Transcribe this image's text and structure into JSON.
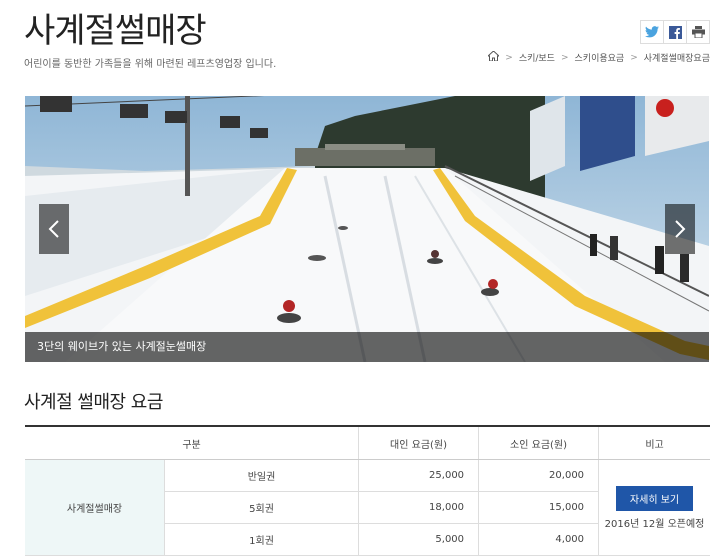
{
  "header": {
    "title": "사계절썰매장",
    "subtitle": "어린이를 동반한 가족들을 위해 마련된 레프츠영업장 입니다."
  },
  "share": {
    "icons": [
      "twitter-icon",
      "facebook-icon",
      "print-icon"
    ]
  },
  "breadcrumb": {
    "items": [
      "스키/보드",
      "스키이용요금",
      "사계절썰매장요금"
    ]
  },
  "hero": {
    "caption": "3단의 웨이브가 있는 사계절눈썰매장"
  },
  "fees": {
    "title": "사계절 썰매장 요금",
    "headers": [
      "구분",
      "대인 요금(원)",
      "소인 요금(원)",
      "비고"
    ],
    "category": "사계절썰매장",
    "rows": [
      {
        "ticket": "반일권",
        "adult": "25,000",
        "child": "20,000"
      },
      {
        "ticket": "5회권",
        "adult": "18,000",
        "child": "15,000"
      },
      {
        "ticket": "1회권",
        "adult": "5,000",
        "child": "4,000"
      }
    ],
    "detail_button": "자세히 보기",
    "note": "2016년 12월 오픈예정"
  },
  "colors": {
    "button": "#1f56a8",
    "category_bg": "#eef7f7"
  }
}
